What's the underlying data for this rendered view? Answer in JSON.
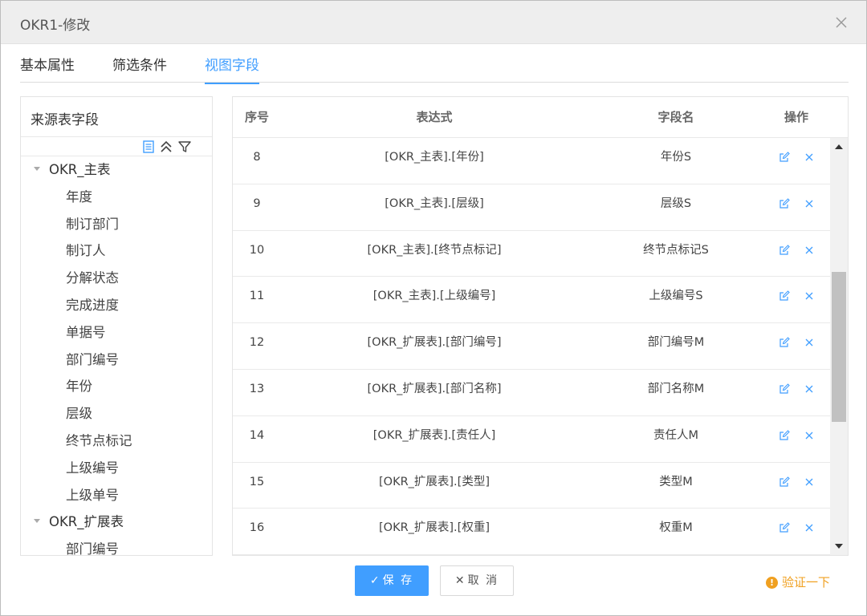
{
  "dialog": {
    "title": "OKR1-修改"
  },
  "tabs": [
    {
      "label": "基本属性",
      "active": false
    },
    {
      "label": "筛选条件",
      "active": false
    },
    {
      "label": "视图字段",
      "active": true
    }
  ],
  "source_panel": {
    "title": "来源表字段",
    "tree": [
      {
        "type": "group",
        "label": "OKR_主表"
      },
      {
        "type": "leaf",
        "label": "年度"
      },
      {
        "type": "leaf",
        "label": "制订部门"
      },
      {
        "type": "leaf",
        "label": "制订人"
      },
      {
        "type": "leaf",
        "label": "分解状态"
      },
      {
        "type": "leaf",
        "label": "完成进度"
      },
      {
        "type": "leaf",
        "label": "单据号"
      },
      {
        "type": "leaf",
        "label": "部门编号"
      },
      {
        "type": "leaf",
        "label": "年份"
      },
      {
        "type": "leaf",
        "label": "层级"
      },
      {
        "type": "leaf",
        "label": "终节点标记"
      },
      {
        "type": "leaf",
        "label": "上级编号"
      },
      {
        "type": "leaf",
        "label": "上级单号"
      },
      {
        "type": "group",
        "label": "OKR_扩展表"
      },
      {
        "type": "leaf",
        "label": "部门编号"
      }
    ]
  },
  "table": {
    "headers": {
      "index": "序号",
      "expression": "表达式",
      "field_name": "字段名",
      "actions": "操作"
    },
    "rows": [
      {
        "index": "8",
        "expression": "[OKR_主表].[年份]",
        "field_name": "年份S"
      },
      {
        "index": "9",
        "expression": "[OKR_主表].[层级]",
        "field_name": "层级S"
      },
      {
        "index": "10",
        "expression": "[OKR_主表].[终节点标记]",
        "field_name": "终节点标记S"
      },
      {
        "index": "11",
        "expression": "[OKR_主表].[上级编号]",
        "field_name": "上级编号S"
      },
      {
        "index": "12",
        "expression": "[OKR_扩展表].[部门编号]",
        "field_name": "部门编号M"
      },
      {
        "index": "13",
        "expression": "[OKR_扩展表].[部门名称]",
        "field_name": "部门名称M"
      },
      {
        "index": "14",
        "expression": "[OKR_扩展表].[责任人]",
        "field_name": "责任人M"
      },
      {
        "index": "15",
        "expression": "[OKR_扩展表].[类型]",
        "field_name": "类型M"
      },
      {
        "index": "16",
        "expression": "[OKR_扩展表].[权重]",
        "field_name": "权重M"
      }
    ]
  },
  "footer": {
    "save_label": "保 存",
    "cancel_label": "取 消",
    "verify_label": "验证一下"
  },
  "colors": {
    "accent": "#409eff",
    "warning": "#f0a020"
  }
}
